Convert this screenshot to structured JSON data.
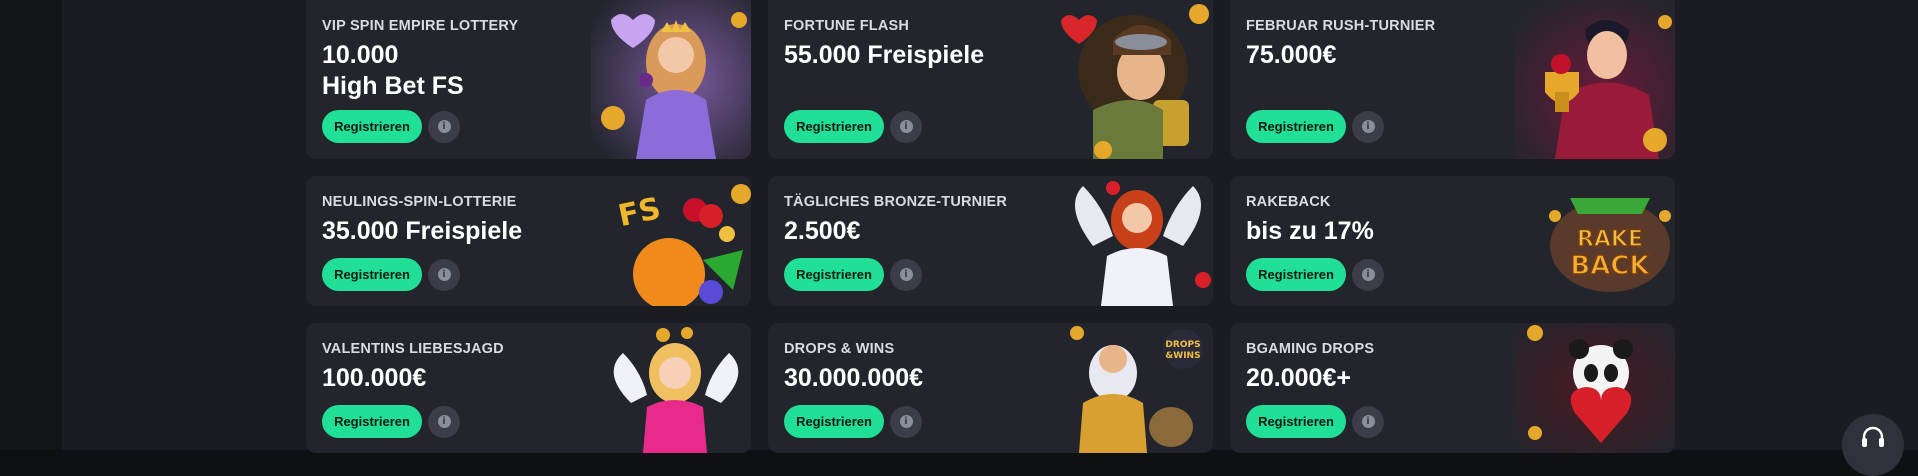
{
  "cards": [
    {
      "title": "VIP SPIN EMPIRE LOTTERY",
      "amount": "10.000\nHigh Bet FS",
      "button": "Registrieren",
      "info_icon": "info-icon",
      "art": "queen-hearts-art"
    },
    {
      "title": "FORTUNE FLASH",
      "amount": "55.000 Freispiele",
      "button": "Registrieren",
      "info_icon": "info-icon",
      "art": "aviator-girl-art"
    },
    {
      "title": "FEBRUAR RUSH-TURNIER",
      "amount": "75.000€",
      "button": "Registrieren",
      "info_icon": "info-icon",
      "art": "gentleman-trophy-art"
    },
    {
      "title": "NEULINGS-SPIN-LOTTERIE",
      "amount": "35.000 Freispiele",
      "button": "Registrieren",
      "info_icon": "info-icon",
      "art": "fruits-fs-art"
    },
    {
      "title": "TÄGLICHES BRONZE-TURNIER",
      "amount": "2.500€",
      "button": "Registrieren",
      "info_icon": "info-icon",
      "art": "angel-woman-art"
    },
    {
      "title": "RAKEBACK",
      "amount": "bis zu 17%",
      "button": "Registrieren",
      "info_icon": "info-icon",
      "art": "rakeback-badge-art",
      "art_text": [
        "RAKE",
        "BACK"
      ]
    },
    {
      "title": "VALENTINS LIEBESJAGD",
      "amount": "100.000€",
      "button": "Registrieren",
      "info_icon": "info-icon",
      "art": "cupid-girl-art"
    },
    {
      "title": "DROPS & WINS",
      "amount": "30.000.000€",
      "button": "Registrieren",
      "info_icon": "info-icon",
      "art": "zeus-art",
      "art_text": [
        "DROPS",
        "&WINS"
      ]
    },
    {
      "title": "BGAMING DROPS",
      "amount": "20.000€+",
      "button": "Registrieren",
      "info_icon": "info-icon",
      "art": "panda-heart-art"
    }
  ],
  "support": {
    "icon": "headset-icon"
  },
  "colors": {
    "accent": "#1fe096",
    "card": "#23252d",
    "background": "#1b1c22"
  }
}
